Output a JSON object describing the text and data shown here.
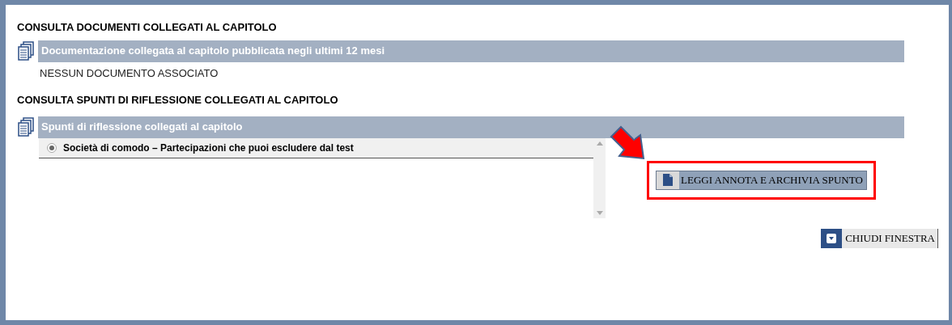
{
  "sections": [
    {
      "heading": "CONSULTA DOCUMENTI COLLEGATI AL CAPITOLO",
      "bar_title": "Documentazione collegata al capitolo pubblicata negli ultimi 12 mesi",
      "empty_message": "NESSUN DOCUMENTO ASSOCIATO"
    },
    {
      "heading": "CONSULTA SPUNTI DI RIFLESSIONE COLLEGATI AL CAPITOLO",
      "bar_title": "Spunti di riflessione collegati al capitolo",
      "items": [
        {
          "label": "Società di comodo – Partecipazioni che puoi escludere dal test",
          "selected": true
        }
      ],
      "action_button": "LEGGI ANNOTA E ARCHIVIA SPUNTO"
    }
  ],
  "close_button": "CHIUDI FINESTRA"
}
